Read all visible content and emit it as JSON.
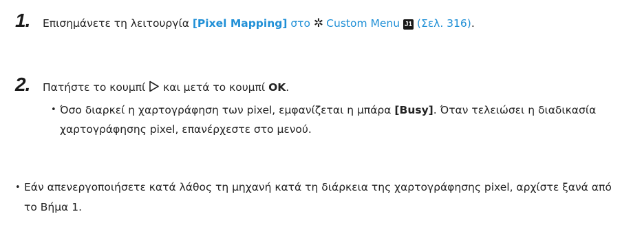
{
  "step1": {
    "number": "1.",
    "text_before": "Επισημάνετε τη λειτουργία ",
    "function_name": "[Pixel Mapping]",
    "text_middle": " στο ",
    "gear_glyph": "✲",
    "menu_link": "Custom Menu",
    "tab_badge": "J1",
    "page_ref": "(Σελ. 316)",
    "text_end": "."
  },
  "step2": {
    "number": "2.",
    "text_before": "Πατήστε το κουμπί ",
    "text_middle": " και μετά το κουμπί ",
    "ok_label": "OK",
    "text_end": ".",
    "note_before": "Όσο διαρκεί η χαρτογράφηση των pixel, εμφανίζεται η μπάρα ",
    "note_bar": "[Busy]",
    "note_after": ". Όταν τελειώσει η διαδικασία χαρτογράφησης pixel, επανέρχεστε στο μενού."
  },
  "note": {
    "bullet": "•",
    "text": "Εάν απενεργοποιήσετε κατά λάθος τη μηχανή κατά τη διάρκεια της χαρτογράφησης pixel, αρχίστε ξανά από το Βήμα 1."
  },
  "colors": {
    "link": "#1f8fd6",
    "text": "#222222"
  },
  "icons": {
    "gear": "gear-icon",
    "tab": "tab-j1-icon",
    "right-arrow": "right-triangle-icon"
  }
}
